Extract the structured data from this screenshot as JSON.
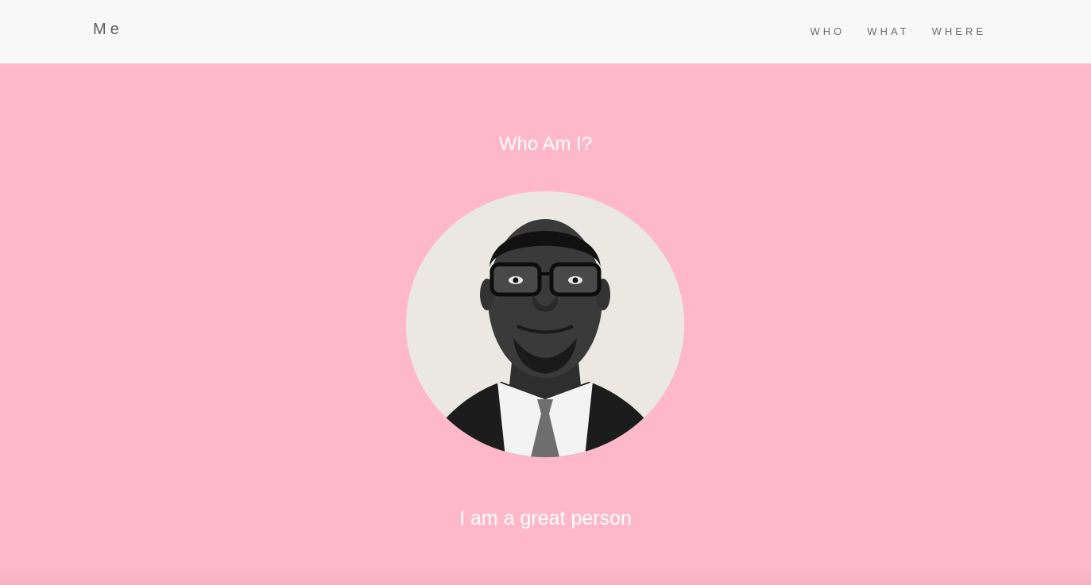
{
  "nav": {
    "brand": "Me",
    "links": [
      {
        "label": "WHO"
      },
      {
        "label": "WHAT"
      },
      {
        "label": "WHERE"
      }
    ]
  },
  "hero": {
    "title": "Who Am I?",
    "tagline": "I am a great person",
    "avatar_icon": "profile-photo",
    "background_color": "#ffb8c9",
    "text_color": "#ffffff"
  }
}
